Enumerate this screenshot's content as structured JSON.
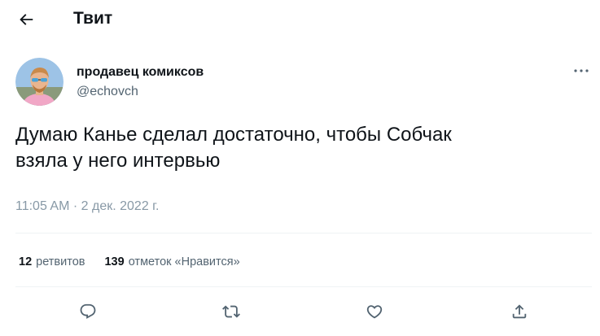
{
  "header": {
    "title": "Твит",
    "back_icon": "arrow-left-icon"
  },
  "author": {
    "name": "продавец комиксов",
    "handle": "@echovch",
    "avatar_icon": "user-avatar"
  },
  "tweet": {
    "text_lines": [
      "Думаю Канье сделал достаточно, чтобы Собчак",
      "взяла у него интервью"
    ],
    "time": "11:05 AM",
    "separator": "·",
    "date": "2 дек. 2022 г."
  },
  "stats": {
    "retweets_count": "12",
    "retweets_label": "ретвитов",
    "likes_count": "139",
    "likes_label": "отметок «Нравится»"
  },
  "actions": [
    {
      "icon": "reply-icon"
    },
    {
      "icon": "retweet-icon"
    },
    {
      "icon": "like-icon"
    },
    {
      "icon": "share-icon"
    }
  ],
  "colors": {
    "text_primary": "#0f1419",
    "text_secondary": "#536471",
    "divider": "#eff3f4",
    "icon": "#536471"
  }
}
